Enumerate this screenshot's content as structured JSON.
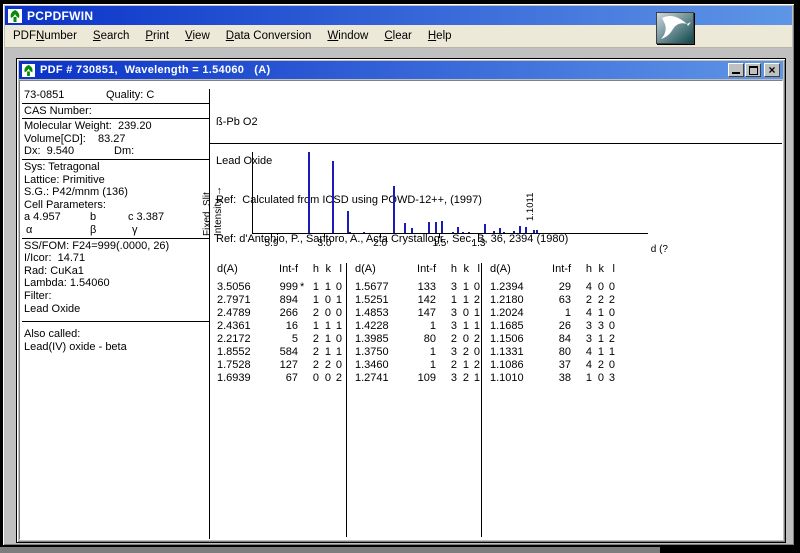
{
  "app": {
    "title": "PCPDFWIN"
  },
  "colors": {
    "titlebar_start": "#0a32c8",
    "titlebar_end": "#5e96e6",
    "window_chrome": "#c0c0c0",
    "menu_bg": "#ece9d8",
    "client_bg": "#ffffff",
    "bar_color": "#1a1ab8",
    "icon_green": "#0a8a0a",
    "logo_teal": "#0e4648"
  },
  "menu": {
    "items": [
      {
        "label": "PDFNumber",
        "u": 3
      },
      {
        "label": "Search",
        "u": 0
      },
      {
        "label": "Print",
        "u": 0
      },
      {
        "label": "View",
        "u": 0
      },
      {
        "label": "Data Conversion",
        "u": 0
      },
      {
        "label": "Window",
        "u": 0
      },
      {
        "label": "Clear",
        "u": 0
      },
      {
        "label": "Help",
        "u": 0
      }
    ]
  },
  "child_window": {
    "title": "PDF # 730851,  Wavelength = 1.54060   (A)"
  },
  "controls": {
    "close": "×"
  },
  "left_panel": {
    "rows": [
      {
        "cells": [
          {
            "t": "73-0851",
            "x": 2
          },
          {
            "t": "Quality: C",
            "x": 84
          }
        ]
      },
      {
        "sep": true
      },
      {
        "cells": [
          {
            "t": "CAS Number:",
            "x": 2
          }
        ]
      },
      {
        "sep": true
      },
      {
        "cells": [
          {
            "t": "Molecular Weight:  239.20",
            "x": 2
          }
        ]
      },
      {
        "cells": [
          {
            "t": "Volume[CD]:    83.27",
            "x": 2
          }
        ]
      },
      {
        "cells": [
          {
            "t": "Dx:  9.540",
            "x": 2
          },
          {
            "t": "Dm:",
            "x": 92
          }
        ]
      },
      {
        "sep": true
      },
      {
        "cells": [
          {
            "t": "Sys: Tetragonal",
            "x": 2
          }
        ]
      },
      {
        "cells": [
          {
            "t": "Lattice: Primitive",
            "x": 2
          }
        ]
      },
      {
        "cells": [
          {
            "t": "S.G.: P42/mnm (136)",
            "x": 2
          }
        ]
      },
      {
        "cells": [
          {
            "t": "Cell Parameters:",
            "x": 2
          }
        ]
      },
      {
        "cells": [
          {
            "t": "a 4.957",
            "x": 2
          },
          {
            "t": "b",
            "x": 68
          },
          {
            "t": "c 3.387",
            "x": 106
          }
        ]
      },
      {
        "cells": [
          {
            "t": "α",
            "x": 4
          },
          {
            "t": "β",
            "x": 68
          },
          {
            "t": "γ",
            "x": 110
          }
        ]
      },
      {
        "sep": true
      },
      {
        "cells": [
          {
            "t": "SS/FOM: F24=999(.0000, 26)",
            "x": 2
          }
        ]
      },
      {
        "cells": [
          {
            "t": "I/Icor:  14.71",
            "x": 2
          }
        ]
      },
      {
        "cells": [
          {
            "t": "Rad: CuKa1",
            "x": 2
          }
        ]
      },
      {
        "cells": [
          {
            "t": "Lambda: 1.54060",
            "x": 2
          }
        ]
      },
      {
        "cells": [
          {
            "t": "Filter:",
            "x": 2
          }
        ]
      },
      {
        "cells": [
          {
            "t": "Lead Oxide",
            "x": 2
          }
        ]
      },
      {
        "gap": 5
      },
      {
        "sep": true
      },
      {
        "gap": 5
      },
      {
        "cells": [
          {
            "t": "Also called:",
            "x": 2
          }
        ]
      },
      {
        "cells": [
          {
            "t": "Lead(IV) oxide - beta",
            "x": 2
          }
        ]
      }
    ]
  },
  "header": {
    "formula": "ß-Pb O2",
    "name": "Lead Oxide",
    "ref1": "Ref:  Calculated from ICSD using POWD-12++, (1997)",
    "ref2": "Ref: d'Antonio, P., Santoro, A., Acta Crystallogr., Sec. B, 36, 2394 (1980)"
  },
  "chart_data": {
    "type": "bar",
    "title": "",
    "ylabel": "Fixed Slit Intensity",
    "ylabel_lines": [
      "Fixed  Slit",
      "Intensity →"
    ],
    "xlabel": "d (?",
    "two_theta_range": [
      10,
      120
    ],
    "ylim": [
      0,
      999
    ],
    "x_ticks": [
      {
        "label": "5.9",
        "tt": 15.01
      },
      {
        "label": "3.0",
        "tt": 29.77
      },
      {
        "label": "2.0",
        "tt": 45.29
      },
      {
        "label": "1.5",
        "tt": 61.77
      },
      {
        "label": "1.3",
        "tt": 72.66
      }
    ],
    "peak_annotation": {
      "text": "1.1011",
      "tt": 88.8
    },
    "peaks": [
      {
        "d": 3.5056,
        "i": 999,
        "tt": 25.38
      },
      {
        "d": 2.7971,
        "i": 894,
        "tt": 31.98
      },
      {
        "d": 2.4789,
        "i": 266,
        "tt": 36.21
      },
      {
        "d": 2.4361,
        "i": 16,
        "tt": 36.86
      },
      {
        "d": 2.2172,
        "i": 5,
        "tt": 40.66
      },
      {
        "d": 1.8552,
        "i": 584,
        "tt": 49.07
      },
      {
        "d": 1.7528,
        "i": 127,
        "tt": 52.14
      },
      {
        "d": 1.6939,
        "i": 67,
        "tt": 54.1
      },
      {
        "d": 1.5677,
        "i": 133,
        "tt": 58.86
      },
      {
        "d": 1.5251,
        "i": 142,
        "tt": 60.67
      },
      {
        "d": 1.4853,
        "i": 147,
        "tt": 62.48
      },
      {
        "d": 1.4228,
        "i": 1,
        "tt": 65.55
      },
      {
        "d": 1.3985,
        "i": 80,
        "tt": 66.85
      },
      {
        "d": 1.375,
        "i": 1,
        "tt": 68.14
      },
      {
        "d": 1.346,
        "i": 1,
        "tt": 69.81
      },
      {
        "d": 1.2741,
        "i": 109,
        "tt": 74.41
      },
      {
        "d": 1.2394,
        "i": 29,
        "tt": 76.83
      },
      {
        "d": 1.218,
        "i": 63,
        "tt": 78.43
      },
      {
        "d": 1.2024,
        "i": 1,
        "tt": 79.65
      },
      {
        "d": 1.1685,
        "i": 26,
        "tt": 82.47
      },
      {
        "d": 1.1506,
        "i": 84,
        "tt": 84.06
      },
      {
        "d": 1.1331,
        "i": 80,
        "tt": 85.68
      },
      {
        "d": 1.1086,
        "i": 37,
        "tt": 88.07
      },
      {
        "d": 1.101,
        "i": 38,
        "tt": 88.84
      }
    ]
  },
  "table": {
    "headers": {
      "d": "d(A)",
      "int": "Int-f",
      "mark": "",
      "h": "h",
      "k": "k",
      "l": "l"
    },
    "groups": [
      {
        "rows": [
          [
            "3.5056",
            "999",
            "*",
            "1",
            "1",
            "0"
          ],
          [
            "2.7971",
            "894",
            "",
            "1",
            "0",
            "1"
          ],
          [
            "2.4789",
            "266",
            "",
            "2",
            "0",
            "0"
          ],
          [
            "2.4361",
            "16",
            "",
            "1",
            "1",
            "1"
          ],
          [
            "2.2172",
            "5",
            "",
            "2",
            "1",
            "0"
          ],
          [
            "1.8552",
            "584",
            "",
            "2",
            "1",
            "1"
          ],
          [
            "1.7528",
            "127",
            "",
            "2",
            "2",
            "0"
          ],
          [
            "1.6939",
            "67",
            "",
            "0",
            "0",
            "2"
          ]
        ]
      },
      {
        "rows": [
          [
            "1.5677",
            "133",
            "",
            "3",
            "1",
            "0"
          ],
          [
            "1.5251",
            "142",
            "",
            "1",
            "1",
            "2"
          ],
          [
            "1.4853",
            "147",
            "",
            "3",
            "0",
            "1"
          ],
          [
            "1.4228",
            "1",
            "",
            "3",
            "1",
            "1"
          ],
          [
            "1.3985",
            "80",
            "",
            "2",
            "0",
            "2"
          ],
          [
            "1.3750",
            "1",
            "",
            "3",
            "2",
            "0"
          ],
          [
            "1.3460",
            "1",
            "",
            "2",
            "1",
            "2"
          ],
          [
            "1.2741",
            "109",
            "",
            "3",
            "2",
            "1"
          ]
        ]
      },
      {
        "rows": [
          [
            "1.2394",
            "29",
            "",
            "4",
            "0",
            "0"
          ],
          [
            "1.2180",
            "63",
            "",
            "2",
            "2",
            "2"
          ],
          [
            "1.2024",
            "1",
            "",
            "4",
            "1",
            "0"
          ],
          [
            "1.1685",
            "26",
            "",
            "3",
            "3",
            "0"
          ],
          [
            "1.1506",
            "84",
            "",
            "3",
            "1",
            "2"
          ],
          [
            "1.1331",
            "80",
            "",
            "4",
            "1",
            "1"
          ],
          [
            "1.1086",
            "37",
            "",
            "4",
            "2",
            "0"
          ],
          [
            "1.1010",
            "38",
            "",
            "1",
            "0",
            "3"
          ]
        ]
      }
    ]
  }
}
